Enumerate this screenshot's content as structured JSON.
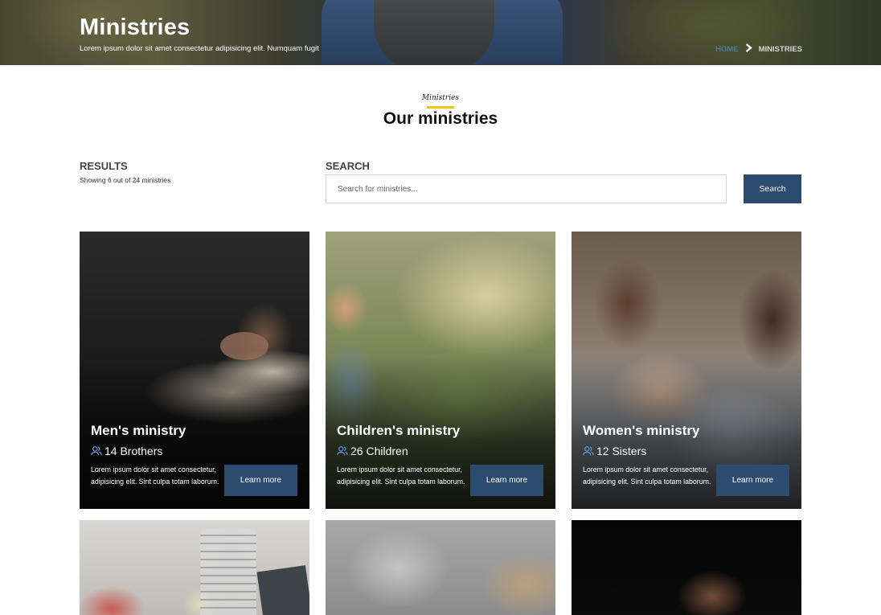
{
  "hero": {
    "title": "Ministries",
    "subtitle": "Lorem ipsum dolor sit amet consectetur adipisicing elit. Numquam fugit",
    "breadcrumb": {
      "home": "HOME",
      "current": "MINISTRIES",
      "separator_icon": "chevron-right-icon"
    }
  },
  "section": {
    "kicker": "Ministries",
    "title": "Our ministries",
    "accent_color": "#f2c400"
  },
  "results": {
    "label": "RESULTS",
    "count_text": "Showing 6 out of 24 ministries"
  },
  "search": {
    "label": "SEARCH",
    "placeholder": "Search for ministries...",
    "value": "",
    "button_label": "Search"
  },
  "colors": {
    "primary_button": "#2b4c6f",
    "breadcrumb_link": "#4a78a8"
  },
  "cards": [
    {
      "title": "Men's ministry",
      "member_icon": "users-icon",
      "members": "14 Brothers",
      "description": "Lorem ipsum dolor sit amet consectetur, adipisicing elit. Sint culpa totam laborum.",
      "button_label": "Learn more"
    },
    {
      "title": "Children's ministry",
      "member_icon": "users-icon",
      "members": "26 Children",
      "description": "Lorem ipsum dolor sit amet consectetur, adipisicing elit. Sint culpa totam laborum.",
      "button_label": "Learn more"
    },
    {
      "title": "Women's ministry",
      "member_icon": "users-icon",
      "members": "12 Sisters",
      "description": "Lorem ipsum dolor sit amet consectetur, adipisicing elit. Sint culpa totam laborum.",
      "button_label": "Learn more"
    }
  ]
}
